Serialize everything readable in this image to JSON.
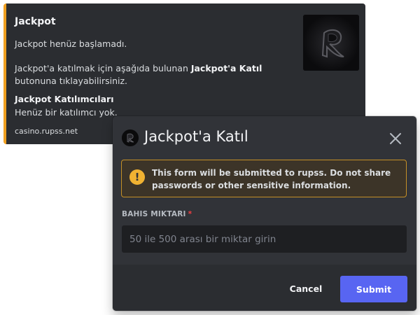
{
  "embed": {
    "accent_color": "#f0a020",
    "title": "Jackpot",
    "description_line1": "Jackpot henüz başlamadı.",
    "description_line2_prefix": "Jackpot'a katılmak için aşağıda bulunan ",
    "description_line2_bold": "Jackpot'a Katıl",
    "description_line3": "butonuna tıklayabilirsiniz.",
    "field_name": "Jackpot Katılımcıları",
    "field_value": "Henüz bir katılımcı yok.",
    "footer": "casino.rupss.net",
    "thumbnail_icon": "logo-icon"
  },
  "modal": {
    "title": "Jackpot'a Katıl",
    "avatar_icon": "bot-avatar-icon",
    "close_icon": "close-icon",
    "warning": {
      "icon": "warning-icon",
      "icon_glyph": "!",
      "text": "This form will be submitted to rupss. Do not share passwords or other sensitive information.",
      "color": "#f0b232"
    },
    "field": {
      "label": "BAHIS MIKTARI",
      "required_mark": "*",
      "value": "",
      "placeholder": "50 ile 500 arası bir miktar girin"
    },
    "cancel_label": "Cancel",
    "submit_label": "Submit",
    "submit_color": "#5865f2"
  }
}
